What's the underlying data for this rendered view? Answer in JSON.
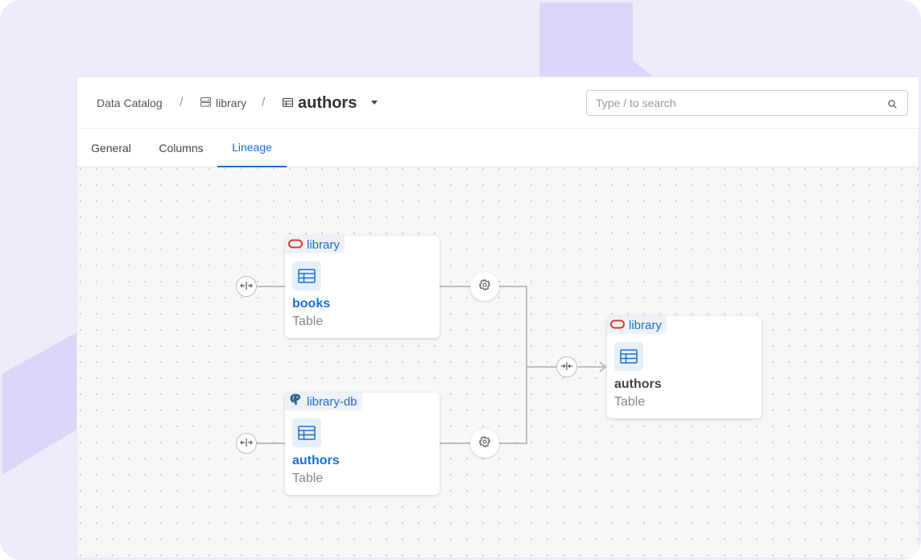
{
  "breadcrumb": {
    "root": "Data Catalog",
    "separator": "/",
    "database": "library",
    "database_icon": "database-icon",
    "current": "authors",
    "current_icon": "table-icon"
  },
  "search": {
    "placeholder": "Type / to search",
    "value": ""
  },
  "tabs": [
    {
      "label": "General",
      "active": false
    },
    {
      "label": "Columns",
      "active": false
    },
    {
      "label": "Lineage",
      "active": true
    }
  ],
  "lineage": {
    "nodes": [
      {
        "source": "library",
        "source_icon": "oracle-icon",
        "name": "books",
        "type": "Table"
      },
      {
        "source": "library-db",
        "source_icon": "postgresql-icon",
        "name": "authors",
        "type": "Table"
      },
      {
        "source": "library",
        "source_icon": "oracle-icon",
        "name": "authors",
        "type": "Table"
      }
    ]
  },
  "colors": {
    "accent": "#1a6fd6",
    "background": "#eeebfb",
    "decoration": "#ddd6f8",
    "oracle": "#d9392b",
    "edge": "#bdbdbd"
  }
}
